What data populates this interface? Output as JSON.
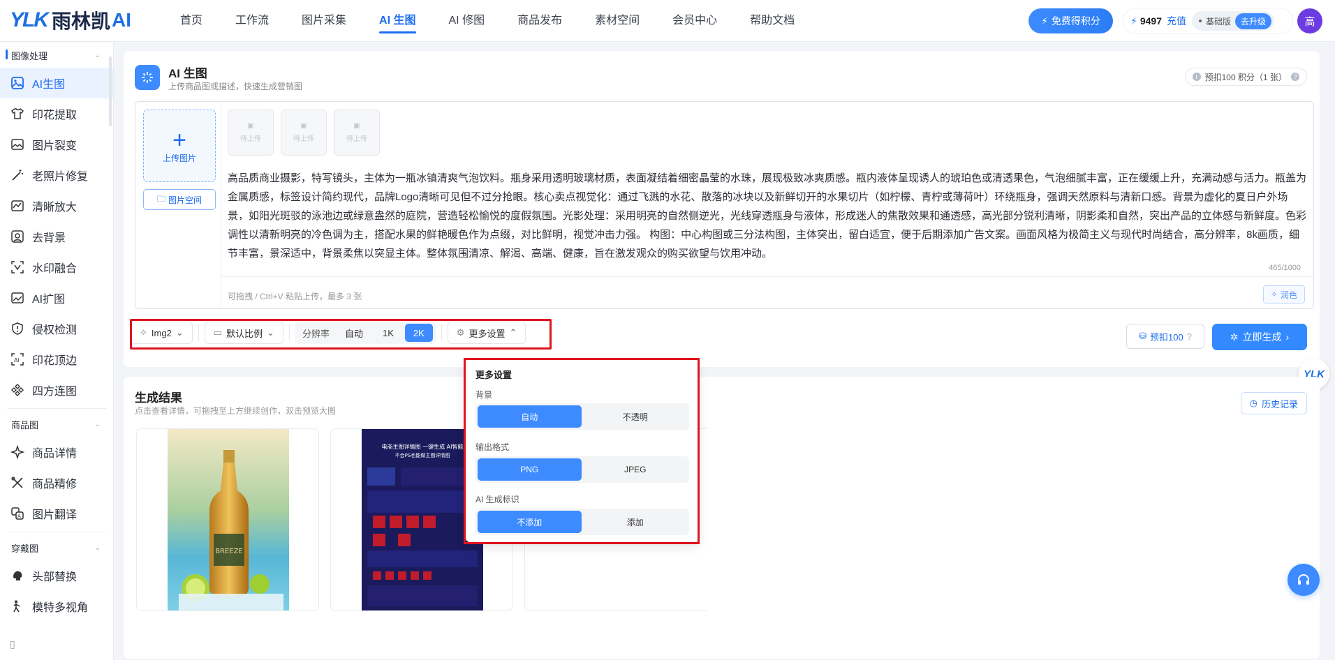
{
  "brand": {
    "mark": "YLK",
    "name": "雨林凯",
    "ai": "AI"
  },
  "nav": [
    "首页",
    "工作流",
    "图片采集",
    "AI 生图",
    "AI 修图",
    "商品发布",
    "素材空间",
    "会员中心",
    "帮助文档"
  ],
  "header": {
    "free_points": "免费得积分",
    "points": "9497",
    "recharge": "充值",
    "tier": "基础版",
    "upgrade": "去升级",
    "avatar": "高"
  },
  "sidebar": {
    "groups": [
      {
        "label": "图像处理",
        "items": [
          "AI生图",
          "印花提取",
          "图片裂变",
          "老照片修复",
          "清晰放大",
          "去背景",
          "水印融合",
          "AI扩图",
          "侵权检测",
          "印花顶边",
          "四方连图"
        ]
      },
      {
        "label": "商品图",
        "items": [
          "商品详情",
          "商品精修",
          "图片翻译"
        ]
      },
      {
        "label": "穿戴图",
        "items": [
          "头部替换",
          "模特多视角"
        ]
      }
    ]
  },
  "panel": {
    "title": "AI 生图",
    "subtitle": "上传商品图或描述，快速生成营销图",
    "estimate": "预扣100 积分（1 张）",
    "upload": "上传图片",
    "space": "图片空间",
    "slot": "待上传",
    "prompt": "高品质商业摄影，特写镜头，主体为一瓶冰镇清爽气泡饮料。瓶身采用透明玻璃材质，表面凝结着细密晶莹的水珠，展现极致冰爽质感。瓶内液体呈现诱人的琥珀色或清透果色，气泡细腻丰富，正在缓缓上升，充满动感与活力。瓶盖为金属质感，标签设计简约现代，品牌Logo清晰可见但不过分抢眼。核心卖点视觉化：通过飞溅的水花、散落的冰块以及新鲜切开的水果切片（如柠檬、青柠或薄荷叶）环绕瓶身，强调天然原料与清新口感。背景为虚化的夏日户外场景，如阳光斑驳的泳池边或绿意盎然的庭院，营造轻松愉悦的度假氛围。光影处理：采用明亮的自然侧逆光，光线穿透瓶身与液体，形成迷人的焦散效果和通透感，高光部分锐利清晰，阴影柔和自然，突出产品的立体感与新鲜度。色彩调性以清新明亮的冷色调为主，搭配水果的鲜艳暖色作为点缀，对比鲜明，视觉冲击力强。 构图：中心构图或三分法构图，主体突出，留白适宜，便于后期添加广告文案。画面风格为极简主义与现代时尚结合，高分辨率，8k画质，细节丰富，景深适中，背景柔焦以突显主体。整体氛围清凉、解渴、高端、健康，旨在激发观众的购买欲望与饮用冲动。",
    "count": "465/1000",
    "hint": "可拖拽 / Ctrl+V 粘贴上传，最多 3 张",
    "polish": "润色",
    "toolbar": {
      "model": "Img2",
      "ratio": "默认比例",
      "res_label": "分辨率",
      "res_options": [
        "自动",
        "1K",
        "2K"
      ],
      "more": "更多设置"
    },
    "pre": "预扣100",
    "generate": "立即生成"
  },
  "results": {
    "title": "生成结果",
    "subtitle": "点击查看详情，可拖拽至上方继续创作，双击预览大图",
    "history": "历史记录",
    "img1_label": "BREEZE",
    "img2_head": "电商主图详情图 一键生成 AI智能",
    "img2_sub": "不会PS也能做主图详情图"
  },
  "popup": {
    "title": "更多设置",
    "bg_label": "背景",
    "bg_options": [
      "自动",
      "不透明"
    ],
    "fmt_label": "输出格式",
    "fmt_options": [
      "PNG",
      "JPEG"
    ],
    "mark_label": "AI 生成标识",
    "mark_options": [
      "不添加",
      "添加"
    ]
  },
  "float_logo": "YLK"
}
